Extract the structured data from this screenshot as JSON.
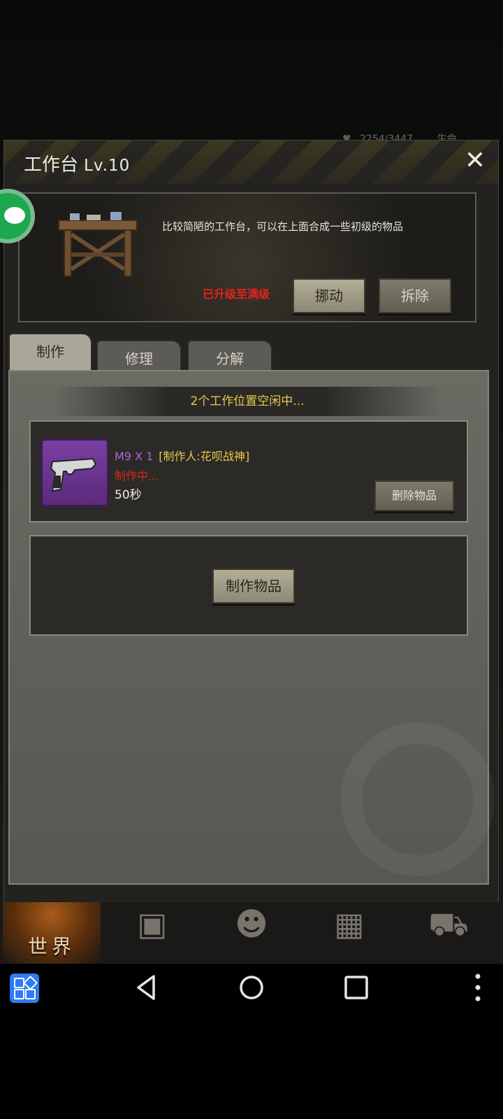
{
  "header": {
    "status_value": "2254/3447",
    "status_label": "生命"
  },
  "dialog": {
    "title": "工作台",
    "level": "Lv.10",
    "description": "比较简陋的工作台，可以在上面合成一些初级的物品",
    "maxed_label": "已升级至满级",
    "move_label": "挪动",
    "remove_label": "拆除"
  },
  "tabs": [
    {
      "label": "制作",
      "active": true
    },
    {
      "label": "修理",
      "active": false
    },
    {
      "label": "分解",
      "active": false
    }
  ],
  "craft": {
    "slots_status": "2个工作位置空闲中...",
    "job": {
      "item_name": "M9 X 1",
      "maker": "[制作人:花呗战神]",
      "status": "制作中...",
      "time_left": "50秒",
      "delete_label": "删除物品",
      "icon": "pistol-icon"
    },
    "empty_slot_button": "制作物品"
  },
  "game_nav": {
    "world_label": "世界",
    "icons": [
      "backpack-icon",
      "head-gear-icon",
      "calculator-icon",
      "cart-icon"
    ]
  },
  "colors": {
    "accent_yellow": "#e8c84c",
    "status_red": "#d8281f",
    "item_purple": "#b55ee0",
    "apps_blue": "#2f7bf3"
  }
}
